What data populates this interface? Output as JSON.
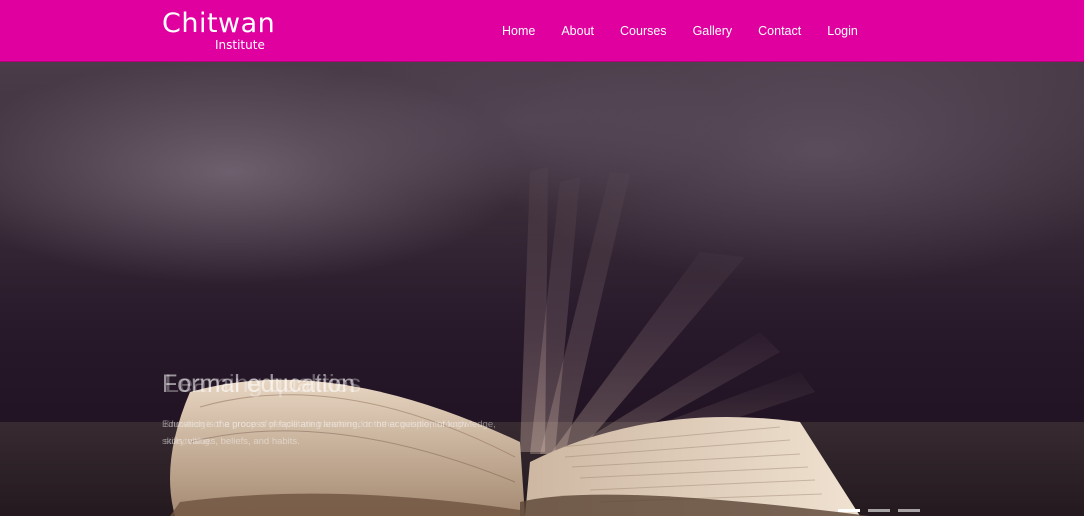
{
  "header": {
    "brand_title": "Chitwan",
    "brand_subtitle": "Institute",
    "nav": [
      "Home",
      "About",
      "Courses",
      "Gallery",
      "Contact",
      "Login"
    ]
  },
  "hero": {
    "slide_title": "Formal education",
    "slide_title_next": "Learning qualities",
    "slide_text": "Education is the process of facilitating learning, or the acquisition of knowledge, skills, values, beliefs, and habits.",
    "slide_text_next": "Knowledge of a group of people are transferred to other people, through storytelling.",
    "slides_count": 3
  },
  "colors": {
    "navbar": "#e0009f",
    "nav_text": "#ffffff"
  }
}
